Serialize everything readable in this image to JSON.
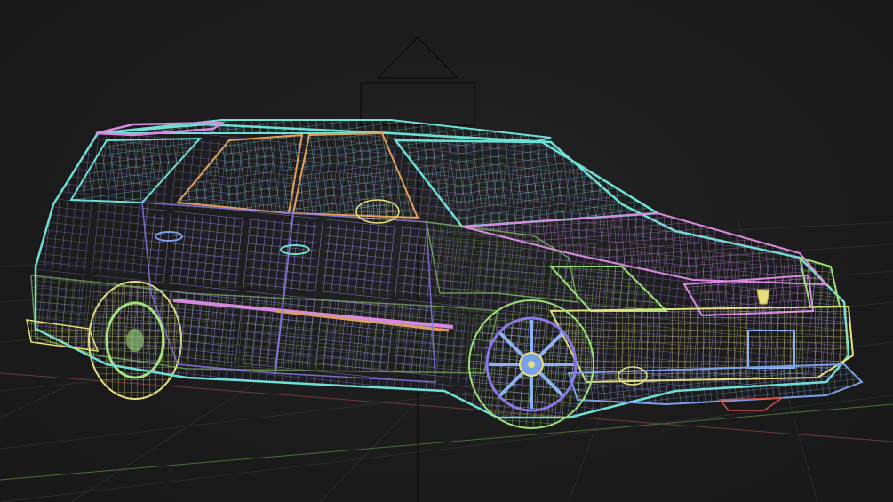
{
  "viewport": {
    "background": "#1c1c1c",
    "grid_color": "#2c2c2c",
    "axis_x_color": "#6b3a3a",
    "axis_z_color": "#4a6a3a"
  },
  "scene": {
    "object": "station-wagon-wireframe",
    "shading": "wireframe",
    "palette": {
      "cyan": "#6fe0d6",
      "green": "#9be07a",
      "yellow": "#e8e07a",
      "purple": "#8a7ae8",
      "pink": "#d98ae0",
      "blue": "#7aa0e8",
      "orange": "#e0a05a",
      "red": "#d05050"
    }
  }
}
